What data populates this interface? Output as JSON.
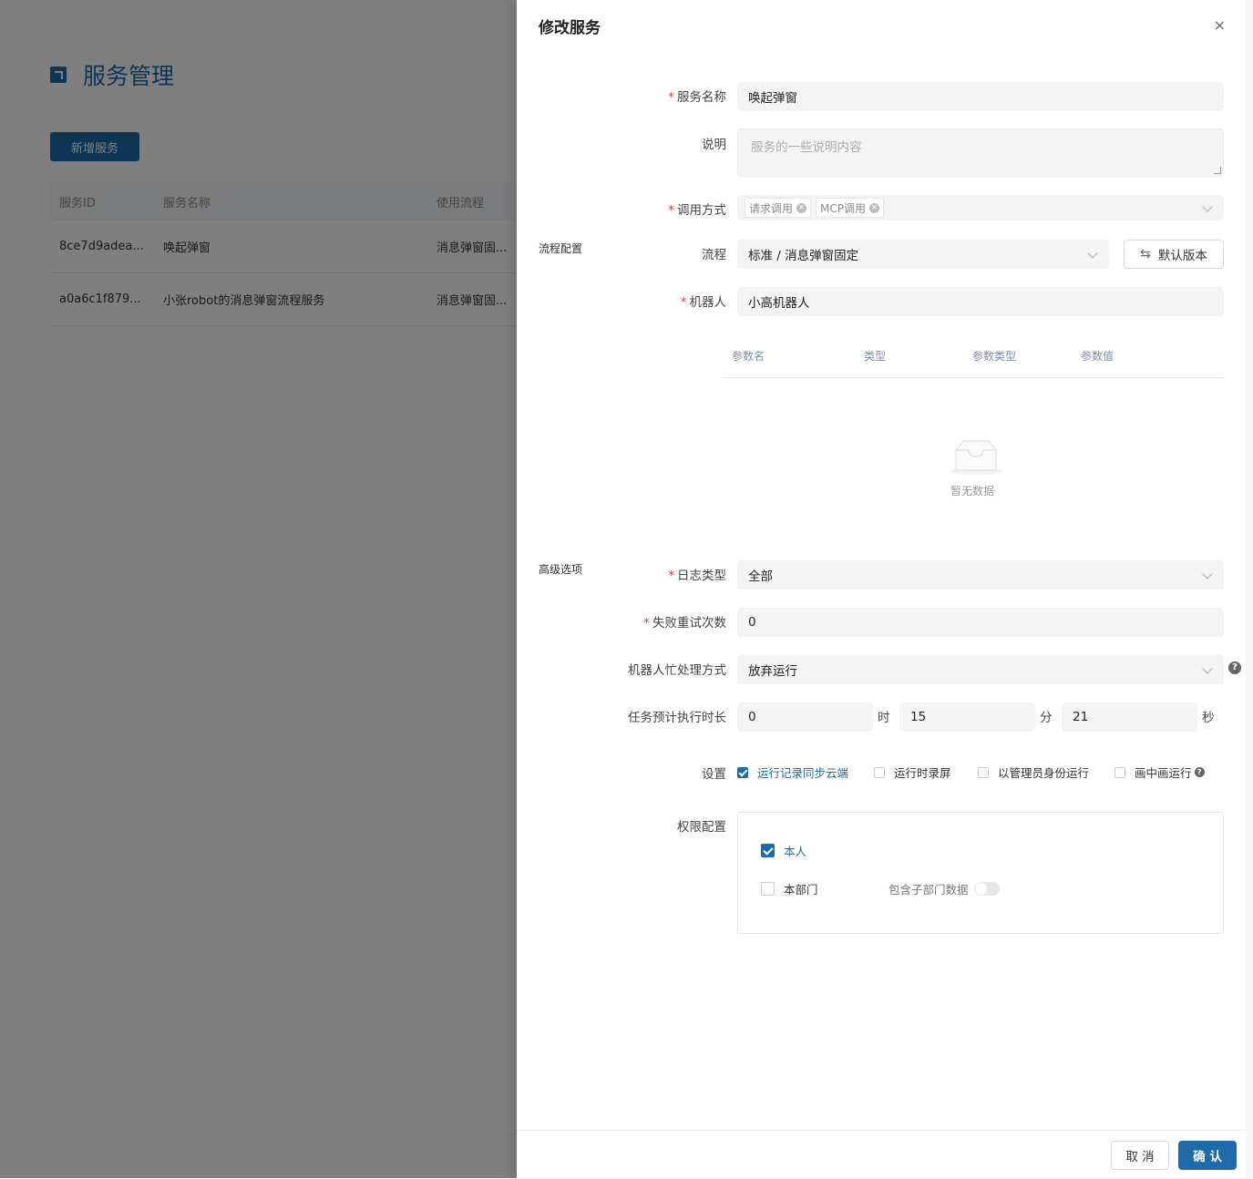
{
  "background": {
    "title": "服务管理",
    "add_button": "新增服务",
    "columns": [
      "服务ID",
      "服务名称",
      "使用流程"
    ],
    "rows": [
      {
        "id": "8ce7d9adea...",
        "name": "唤起弹窗",
        "flow": "消息弹窗固..."
      },
      {
        "id": "a0a6c1f879...",
        "name": "小张robot的消息弹窗流程服务",
        "flow": "消息弹窗固..."
      }
    ]
  },
  "drawer": {
    "title": "修改服务",
    "close": "×",
    "sections": {
      "flow_config": "流程配置",
      "advanced": "高级选项"
    },
    "fields": {
      "service_name": {
        "label": "服务名称",
        "value": "唤起弹窗"
      },
      "description": {
        "label": "说明",
        "placeholder": "服务的一些说明内容"
      },
      "invoke_mode": {
        "label": "调用方式",
        "tags": [
          "请求调用",
          "MCP调用"
        ]
      },
      "flow": {
        "label": "流程",
        "value": "标准 / 消息弹窗固定",
        "version_button": "默认版本"
      },
      "robot": {
        "label": "机器人",
        "value": "小高机器人"
      },
      "param_table": {
        "columns": [
          "参数名",
          "类型",
          "参数类型",
          "参数值"
        ],
        "empty_text": "暂无数据"
      },
      "log_type": {
        "label": "日志类型",
        "value": "全部"
      },
      "retry": {
        "label": "失败重试次数",
        "value": "0"
      },
      "busy_mode": {
        "label": "机器人忙处理方式",
        "value": "放弃运行"
      },
      "duration": {
        "label": "任务预计执行时长",
        "hours": "0",
        "hours_unit": "时",
        "minutes": "15",
        "minutes_unit": "分",
        "seconds": "21",
        "seconds_unit": "秒"
      },
      "settings": {
        "label": "设置",
        "options": [
          {
            "label": "运行记录同步云端",
            "checked": true
          },
          {
            "label": "运行时录屏",
            "checked": false
          },
          {
            "label": "以管理员身份运行",
            "checked": false
          },
          {
            "label": "画中画运行",
            "checked": false
          }
        ]
      },
      "permissions": {
        "label": "权限配置",
        "self": {
          "label": "本人",
          "checked": true
        },
        "dept": {
          "label": "本部门",
          "checked": false
        },
        "sub_dept": {
          "label": "包含子部门数据",
          "on": false
        }
      }
    },
    "footer": {
      "cancel": "取 消",
      "confirm": "确 认"
    }
  },
  "colors": {
    "accent": "#1f6aa8",
    "required": "#e2393a"
  }
}
